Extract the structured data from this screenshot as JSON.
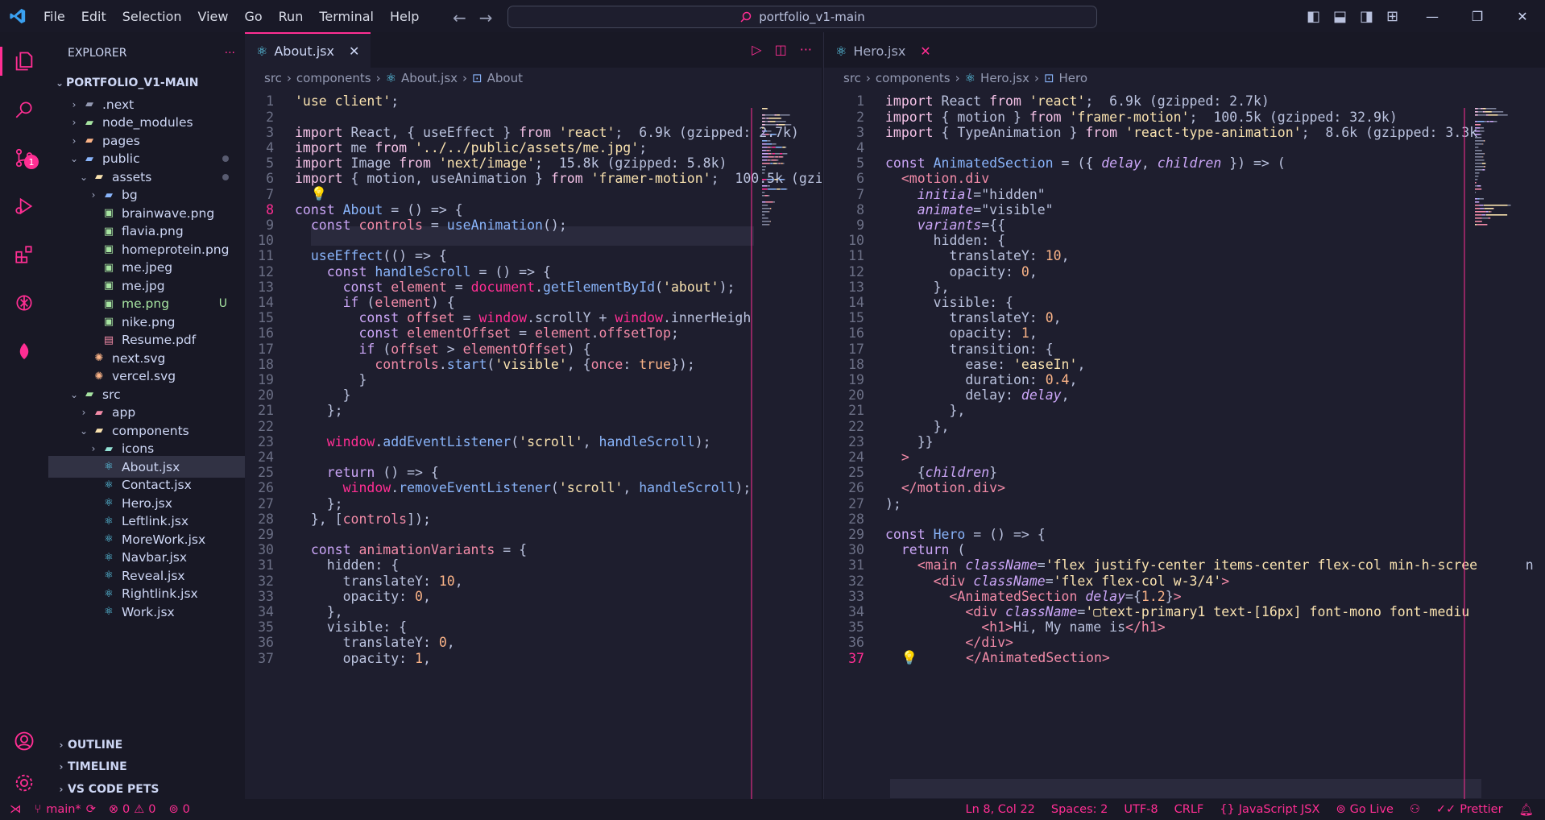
{
  "window": {
    "menu": [
      "File",
      "Edit",
      "Selection",
      "View",
      "Go",
      "Run",
      "Terminal",
      "Help"
    ],
    "search_text": "portfolio_v1-main"
  },
  "activity_bar": {
    "icons": [
      "explorer-icon",
      "search-icon",
      "source-control-icon",
      "run-debug-icon",
      "extensions-icon",
      "openai-icon",
      "leaf-icon",
      "account-icon",
      "settings-gear-icon"
    ],
    "source_control_badge": "1"
  },
  "explorer": {
    "title": "EXPLORER",
    "more": "···",
    "root": "PORTFOLIO_V1-MAIN",
    "tree": [
      {
        "label": ".next",
        "depth": 1,
        "type": "folder",
        "open": false,
        "icon": "folder-gray"
      },
      {
        "label": "node_modules",
        "depth": 1,
        "type": "folder",
        "open": false,
        "icon": "folder-green"
      },
      {
        "label": "pages",
        "depth": 1,
        "type": "folder",
        "open": false,
        "icon": "folder-orange"
      },
      {
        "label": "public",
        "depth": 1,
        "type": "folder",
        "open": true,
        "icon": "folder-blue",
        "dot": true
      },
      {
        "label": "assets",
        "depth": 2,
        "type": "folder",
        "open": true,
        "icon": "folder-yellow",
        "dot": true
      },
      {
        "label": "bg",
        "depth": 3,
        "type": "folder",
        "open": false,
        "icon": "folder-blue"
      },
      {
        "label": "brainwave.png",
        "depth": 3,
        "type": "file",
        "icon": "image"
      },
      {
        "label": "flavia.png",
        "depth": 3,
        "type": "file",
        "icon": "image"
      },
      {
        "label": "homeprotein.png",
        "depth": 3,
        "type": "file",
        "icon": "image"
      },
      {
        "label": "me.jpeg",
        "depth": 3,
        "type": "file",
        "icon": "image"
      },
      {
        "label": "me.jpg",
        "depth": 3,
        "type": "file",
        "icon": "image"
      },
      {
        "label": "me.png",
        "depth": 3,
        "type": "file",
        "icon": "image",
        "status": "U",
        "green": true
      },
      {
        "label": "nike.png",
        "depth": 3,
        "type": "file",
        "icon": "image"
      },
      {
        "label": "Resume.pdf",
        "depth": 3,
        "type": "file",
        "icon": "pdf"
      },
      {
        "label": "next.svg",
        "depth": 2,
        "type": "file",
        "icon": "svg"
      },
      {
        "label": "vercel.svg",
        "depth": 2,
        "type": "file",
        "icon": "svg"
      },
      {
        "label": "src",
        "depth": 1,
        "type": "folder",
        "open": true,
        "icon": "folder-green"
      },
      {
        "label": "app",
        "depth": 2,
        "type": "folder",
        "open": false,
        "icon": "folder-red"
      },
      {
        "label": "components",
        "depth": 2,
        "type": "folder",
        "open": true,
        "icon": "folder-yellow"
      },
      {
        "label": "icons",
        "depth": 3,
        "type": "folder",
        "open": false,
        "icon": "folder-teal"
      },
      {
        "label": "About.jsx",
        "depth": 3,
        "type": "file",
        "icon": "react",
        "selected": true
      },
      {
        "label": "Contact.jsx",
        "depth": 3,
        "type": "file",
        "icon": "react"
      },
      {
        "label": "Hero.jsx",
        "depth": 3,
        "type": "file",
        "icon": "react"
      },
      {
        "label": "Leftlink.jsx",
        "depth": 3,
        "type": "file",
        "icon": "react"
      },
      {
        "label": "MoreWork.jsx",
        "depth": 3,
        "type": "file",
        "icon": "react"
      },
      {
        "label": "Navbar.jsx",
        "depth": 3,
        "type": "file",
        "icon": "react"
      },
      {
        "label": "Reveal.jsx",
        "depth": 3,
        "type": "file",
        "icon": "react"
      },
      {
        "label": "Rightlink.jsx",
        "depth": 3,
        "type": "file",
        "icon": "react"
      },
      {
        "label": "Work.jsx",
        "depth": 3,
        "type": "file",
        "icon": "react"
      }
    ],
    "sections": [
      "OUTLINE",
      "TIMELINE",
      "VS CODE PETS"
    ]
  },
  "editor_left": {
    "tab": "About.jsx",
    "breadcrumb": [
      "src",
      "components",
      "About.jsx",
      "About"
    ],
    "current_line": 8,
    "lines": [
      [
        [
          "s",
          "'use client'"
        ],
        [
          "g",
          ";"
        ]
      ],
      [],
      [
        [
          "k",
          "import "
        ],
        [
          "g",
          "React, { useEffect } "
        ],
        [
          "k",
          "from "
        ],
        [
          "s",
          "'react'"
        ],
        [
          "g",
          ";  6.9k (gzipped: 2.7k)"
        ]
      ],
      [
        [
          "k",
          "import "
        ],
        [
          "g",
          "me "
        ],
        [
          "k",
          "from "
        ],
        [
          "s",
          "'../../public/assets/me.jpg'"
        ],
        [
          "g",
          ";"
        ]
      ],
      [
        [
          "k",
          "import "
        ],
        [
          "g",
          "Image "
        ],
        [
          "k",
          "from "
        ],
        [
          "s",
          "'next/image'"
        ],
        [
          "g",
          ";  15.8k (gzipped: 5.8k)"
        ]
      ],
      [
        [
          "k",
          "import "
        ],
        [
          "g",
          "{ motion, useAnimation } "
        ],
        [
          "k",
          "from "
        ],
        [
          "s",
          "'framer-motion'"
        ],
        [
          "g",
          ";  100.5k (gzi"
        ]
      ],
      [
        [
          "s",
          "  💡"
        ]
      ],
      [
        [
          "kw",
          "const "
        ],
        [
          "f",
          "About"
        ],
        [
          "g",
          " = () => {"
        ]
      ],
      [
        [
          "kw",
          "  const "
        ],
        [
          "v",
          "controls"
        ],
        [
          "g",
          " = "
        ],
        [
          "f",
          "useAnimation"
        ],
        [
          "g",
          "();"
        ]
      ],
      [],
      [
        [
          "f",
          "  useEffect"
        ],
        [
          "g",
          "(() => {"
        ]
      ],
      [
        [
          "kw",
          "    const "
        ],
        [
          "f",
          "handleScroll"
        ],
        [
          "g",
          " = () => {"
        ]
      ],
      [
        [
          "kw",
          "      const "
        ],
        [
          "v",
          "element"
        ],
        [
          "g",
          " = "
        ],
        [
          "fn",
          "document"
        ],
        [
          "g",
          "."
        ],
        [
          "f",
          "getElementById"
        ],
        [
          "g",
          "("
        ],
        [
          "s",
          "'about'"
        ],
        [
          "g",
          ");"
        ]
      ],
      [
        [
          "kw",
          "      if "
        ],
        [
          "g",
          "("
        ],
        [
          "v",
          "element"
        ],
        [
          "g",
          ") {"
        ]
      ],
      [
        [
          "kw",
          "        const "
        ],
        [
          "v",
          "offset"
        ],
        [
          "g",
          " = "
        ],
        [
          "fn",
          "window"
        ],
        [
          "g",
          ".scrollY + "
        ],
        [
          "fn",
          "window"
        ],
        [
          "g",
          ".innerHeigh"
        ]
      ],
      [
        [
          "kw",
          "        const "
        ],
        [
          "v",
          "elementOffset"
        ],
        [
          "g",
          " = "
        ],
        [
          "v",
          "element"
        ],
        [
          "g",
          "."
        ],
        [
          "v",
          "offsetTop"
        ],
        [
          "g",
          ";"
        ]
      ],
      [
        [
          "kw",
          "        if "
        ],
        [
          "g",
          "("
        ],
        [
          "v",
          "offset"
        ],
        [
          "g",
          " > "
        ],
        [
          "v",
          "elementOffset"
        ],
        [
          "g",
          ") {"
        ]
      ],
      [
        [
          "v",
          "          controls"
        ],
        [
          "g",
          "."
        ],
        [
          "f",
          "start"
        ],
        [
          "g",
          "("
        ],
        [
          "s",
          "'visible'"
        ],
        [
          "g",
          ", {"
        ],
        [
          "v",
          "once"
        ],
        [
          "g",
          ": "
        ],
        [
          "n",
          "true"
        ],
        [
          "g",
          "});"
        ]
      ],
      [
        [
          "g",
          "        }"
        ]
      ],
      [
        [
          "g",
          "      }"
        ]
      ],
      [
        [
          "g",
          "    };"
        ]
      ],
      [],
      [
        [
          "fn",
          "    window"
        ],
        [
          "g",
          "."
        ],
        [
          "f",
          "addEventListener"
        ],
        [
          "g",
          "("
        ],
        [
          "s",
          "'scroll'"
        ],
        [
          "g",
          ", "
        ],
        [
          "f",
          "handleScroll"
        ],
        [
          "g",
          ");"
        ]
      ],
      [],
      [
        [
          "kw",
          "    return "
        ],
        [
          "g",
          "() => {"
        ]
      ],
      [
        [
          "fn",
          "      window"
        ],
        [
          "g",
          "."
        ],
        [
          "f",
          "removeEventListener"
        ],
        [
          "g",
          "("
        ],
        [
          "s",
          "'scroll'"
        ],
        [
          "g",
          ", "
        ],
        [
          "f",
          "handleScroll"
        ],
        [
          "g",
          ");"
        ]
      ],
      [
        [
          "g",
          "    };"
        ]
      ],
      [
        [
          "g",
          "  }, ["
        ],
        [
          "v",
          "controls"
        ],
        [
          "g",
          "]);"
        ]
      ],
      [],
      [
        [
          "kw",
          "  const "
        ],
        [
          "v",
          "animationVariants"
        ],
        [
          "g",
          " = {"
        ]
      ],
      [
        [
          "g",
          "    hidden: {"
        ]
      ],
      [
        [
          "g",
          "      translateY: "
        ],
        [
          "n",
          "10"
        ],
        [
          "g",
          ","
        ]
      ],
      [
        [
          "g",
          "      opacity: "
        ],
        [
          "n",
          "0"
        ],
        [
          "g",
          ","
        ]
      ],
      [
        [
          "g",
          "    },"
        ]
      ],
      [
        [
          "g",
          "    visible: {"
        ]
      ],
      [
        [
          "g",
          "      translateY: "
        ],
        [
          "n",
          "0"
        ],
        [
          "g",
          ","
        ]
      ],
      [
        [
          "g",
          "      opacity: "
        ],
        [
          "n",
          "1"
        ],
        [
          "g",
          ","
        ]
      ]
    ]
  },
  "editor_right": {
    "tab": "Hero.jsx",
    "breadcrumb": [
      "src",
      "components",
      "Hero.jsx",
      "Hero"
    ],
    "current_line": 37,
    "lines": [
      [
        [
          "k",
          "import "
        ],
        [
          "g",
          "React "
        ],
        [
          "k",
          "from "
        ],
        [
          "s",
          "'react'"
        ],
        [
          "g",
          ";  6.9k (gzipped: 2.7k)"
        ]
      ],
      [
        [
          "k",
          "import "
        ],
        [
          "g",
          "{ motion } "
        ],
        [
          "k",
          "from "
        ],
        [
          "s",
          "'framer-motion'"
        ],
        [
          "g",
          ";  100.5k (gzipped: 32.9k)"
        ]
      ],
      [
        [
          "k",
          "import "
        ],
        [
          "g",
          "{ TypeAnimation } "
        ],
        [
          "k",
          "from "
        ],
        [
          "s",
          "'react-type-animation'"
        ],
        [
          "g",
          ";  8.6k (gzipped: 3.3k"
        ]
      ],
      [],
      [
        [
          "kw",
          "const "
        ],
        [
          "f",
          "AnimatedSection"
        ],
        [
          "g",
          " = ({ "
        ],
        [
          "a",
          "delay"
        ],
        [
          "g",
          ", "
        ],
        [
          "a",
          "children"
        ],
        [
          "g",
          " }) => ("
        ]
      ],
      [
        [
          "t",
          "  <motion.div"
        ]
      ],
      [
        [
          "a",
          "    initial"
        ],
        [
          "g",
          "=\"hidden\""
        ]
      ],
      [
        [
          "a",
          "    animate"
        ],
        [
          "g",
          "=\"visible\""
        ]
      ],
      [
        [
          "a",
          "    variants"
        ],
        [
          "g",
          "={{"
        ]
      ],
      [
        [
          "g",
          "      hidden: {"
        ]
      ],
      [
        [
          "g",
          "        translateY: "
        ],
        [
          "n",
          "10"
        ],
        [
          "g",
          ","
        ]
      ],
      [
        [
          "g",
          "        opacity: "
        ],
        [
          "n",
          "0"
        ],
        [
          "g",
          ","
        ]
      ],
      [
        [
          "g",
          "      },"
        ]
      ],
      [
        [
          "g",
          "      visible: {"
        ]
      ],
      [
        [
          "g",
          "        translateY: "
        ],
        [
          "n",
          "0"
        ],
        [
          "g",
          ","
        ]
      ],
      [
        [
          "g",
          "        opacity: "
        ],
        [
          "n",
          "1"
        ],
        [
          "g",
          ","
        ]
      ],
      [
        [
          "g",
          "        transition: {"
        ]
      ],
      [
        [
          "g",
          "          ease: "
        ],
        [
          "s",
          "'easeIn'"
        ],
        [
          "g",
          ","
        ]
      ],
      [
        [
          "g",
          "          duration: "
        ],
        [
          "n",
          "0.4"
        ],
        [
          "g",
          ","
        ]
      ],
      [
        [
          "g",
          "          delay: "
        ],
        [
          "a",
          "delay"
        ],
        [
          "g",
          ","
        ]
      ],
      [
        [
          "g",
          "        },"
        ]
      ],
      [
        [
          "g",
          "      },"
        ]
      ],
      [
        [
          "g",
          "    }}"
        ]
      ],
      [
        [
          "t",
          "  >"
        ]
      ],
      [
        [
          "g",
          "    {"
        ],
        [
          "a",
          "children"
        ],
        [
          "g",
          "}"
        ]
      ],
      [
        [
          "t",
          "  </motion.div>"
        ]
      ],
      [
        [
          "g",
          ");"
        ]
      ],
      [],
      [
        [
          "kw",
          "const "
        ],
        [
          "f",
          "Hero"
        ],
        [
          "g",
          " = () => {"
        ]
      ],
      [
        [
          "kw",
          "  return "
        ],
        [
          "g",
          "("
        ]
      ],
      [
        [
          "t",
          "    <main "
        ],
        [
          "a",
          "className"
        ],
        [
          "g",
          "="
        ],
        [
          "s",
          "'flex justify-center items-center flex-col min-h-scree"
        ],
        [
          "g",
          "      n"
        ]
      ],
      [
        [
          "t",
          "      <div "
        ],
        [
          "a",
          "className"
        ],
        [
          "g",
          "="
        ],
        [
          "s",
          "'flex flex-col w-3/4'"
        ],
        [
          "t",
          ">"
        ]
      ],
      [
        [
          "t",
          "        <AnimatedSection "
        ],
        [
          "a",
          "delay"
        ],
        [
          "g",
          "={"
        ],
        [
          "n",
          "1.2"
        ],
        [
          "g",
          "}"
        ],
        [
          "t",
          ">"
        ]
      ],
      [
        [
          "t",
          "          <div "
        ],
        [
          "a",
          "className"
        ],
        [
          "g",
          "="
        ],
        [
          "s",
          "'▢text-primary1 text-[16px] font-mono font-mediu"
        ]
      ],
      [
        [
          "t",
          "            <h1>"
        ],
        [
          "g",
          "Hi, My name is"
        ],
        [
          "t",
          "</h1>"
        ]
      ],
      [
        [
          "t",
          "          </div>"
        ]
      ],
      [
        [
          "s",
          "  💡"
        ],
        [
          "t",
          "      </AnimatedSection>"
        ]
      ]
    ]
  },
  "statusbar": {
    "branch": "main*",
    "errors": "0",
    "warnings": "0",
    "ports": "0",
    "position": "Ln 8, Col 22",
    "spaces": "Spaces: 2",
    "encoding": "UTF-8",
    "eol": "CRLF",
    "language": "JavaScript JSX",
    "golive": "Go Live",
    "prettier": "Prettier"
  }
}
